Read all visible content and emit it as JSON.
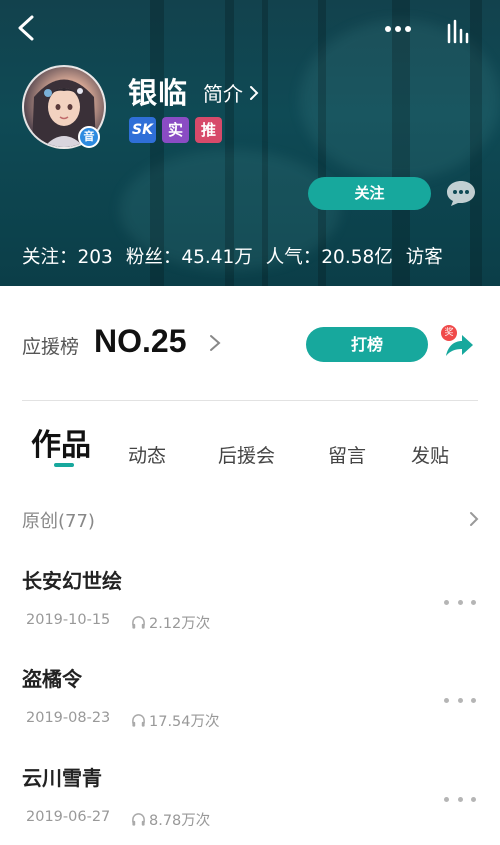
{
  "header": {
    "username": "银临",
    "intro_label": "简介",
    "avatar_badge": "音",
    "tags": [
      "ЅΚ",
      "实",
      "推"
    ],
    "follow_label": "关注",
    "stats": {
      "following": "关注：203",
      "fans": "粉丝：45.41万",
      "popularity": "人气：20.58亿",
      "visitors": "访客"
    }
  },
  "rank": {
    "label": "应援榜",
    "value": "NO.25",
    "cheer_label": "打榜",
    "share_badge": "奖"
  },
  "tabs": [
    {
      "label": "作品",
      "active": true
    },
    {
      "label": "动态",
      "active": false
    },
    {
      "label": "后援会",
      "active": false
    },
    {
      "label": "留言",
      "active": false
    },
    {
      "label": "发贴",
      "active": false
    }
  ],
  "works": {
    "section_title": "原创(77)",
    "items": [
      {
        "title": "长安幻世绘",
        "date": "2019-10-15",
        "plays": "2.12万次"
      },
      {
        "title": "盗橘令",
        "date": "2019-08-23",
        "plays": "17.54万次"
      },
      {
        "title": "云川雪青",
        "date": "2019-06-27",
        "plays": "8.78万次"
      }
    ]
  },
  "colors": {
    "accent": "#17a89d",
    "header_bg": "#0f4a55"
  },
  "icons": [
    "back-arrow-icon",
    "more-dots-icon",
    "chart-bars-icon",
    "message-bubble-icon",
    "chevron-right-icon",
    "share-arrow-icon",
    "headphones-icon"
  ]
}
